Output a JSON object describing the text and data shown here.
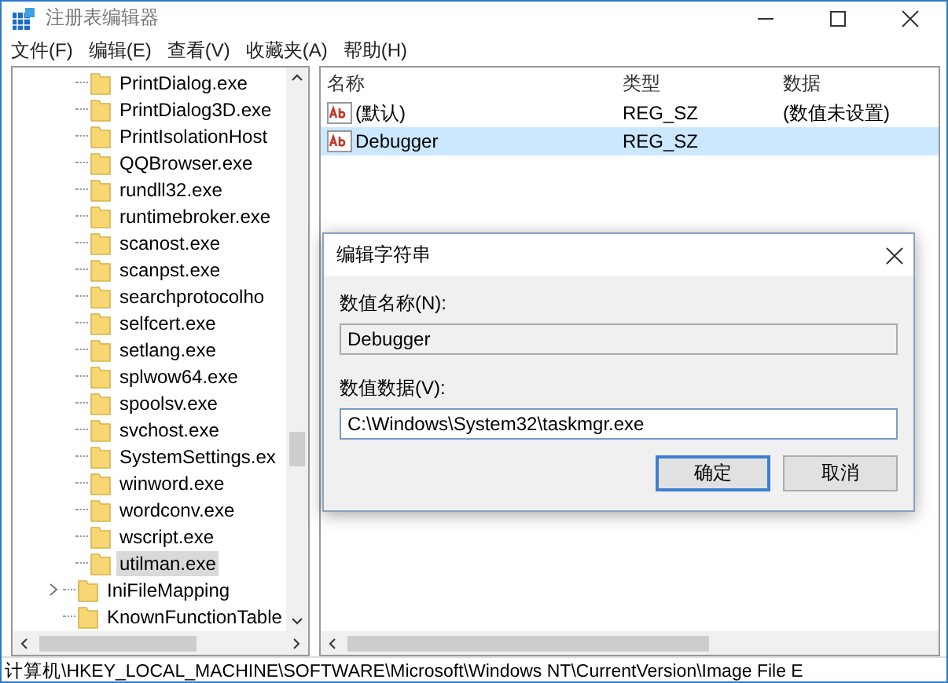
{
  "window": {
    "title": "注册表编辑器"
  },
  "menu": [
    "文件(F)",
    "编辑(E)",
    "查看(V)",
    "收藏夹(A)",
    "帮助(H)"
  ],
  "tree": {
    "items": [
      {
        "children": [
          {
            "label": "PrintDialog.exe",
            "selected": false
          },
          {
            "label": "PrintDialog3D.exe",
            "selected": false
          },
          {
            "label": "PrintIsolationHost",
            "selected": false
          },
          {
            "label": "QQBrowser.exe",
            "selected": false
          },
          {
            "label": "rundll32.exe",
            "selected": false
          },
          {
            "label": "runtimebroker.exe",
            "selected": false
          },
          {
            "label": "scanost.exe",
            "selected": false
          },
          {
            "label": "scanpst.exe",
            "selected": false
          },
          {
            "label": "searchprotocolho",
            "selected": false
          },
          {
            "label": "selfcert.exe",
            "selected": false
          },
          {
            "label": "setlang.exe",
            "selected": false
          },
          {
            "label": "splwow64.exe",
            "selected": false
          },
          {
            "label": "spoolsv.exe",
            "selected": false
          },
          {
            "label": "svchost.exe",
            "selected": false
          },
          {
            "label": "SystemSettings.ex",
            "selected": false
          },
          {
            "label": "winword.exe",
            "selected": false
          },
          {
            "label": "wordconv.exe",
            "selected": false
          },
          {
            "label": "wscript.exe",
            "selected": false
          },
          {
            "label": "utilman.exe",
            "selected": true
          }
        ]
      },
      {
        "label": "IniFileMapping",
        "expandable": true,
        "selected": false
      },
      {
        "label": "KnownFunctionTable",
        "expandable": false,
        "selected": false
      }
    ]
  },
  "values": {
    "columns": [
      "名称",
      "类型",
      "数据"
    ],
    "rows": [
      {
        "name": "(默认)",
        "type": "REG_SZ",
        "data": "(数值未设置)",
        "selected": false
      },
      {
        "name": "Debugger",
        "type": "REG_SZ",
        "selected": true
      }
    ]
  },
  "dialog": {
    "title": "编辑字符串",
    "name_label": "数值名称(N):",
    "name_value": "Debugger",
    "data_label": "数值数据(V):",
    "data_value": "C:\\Windows\\System32\\taskmgr.exe",
    "buttons": [
      {
        "label": "确定",
        "default": true
      },
      {
        "label": "取消",
        "default": false
      }
    ]
  },
  "status_bar": "计算机\\HKEY_LOCAL_MACHINE\\SOFTWARE\\Microsoft\\Windows NT\\CurrentVersion\\Image File E"
}
